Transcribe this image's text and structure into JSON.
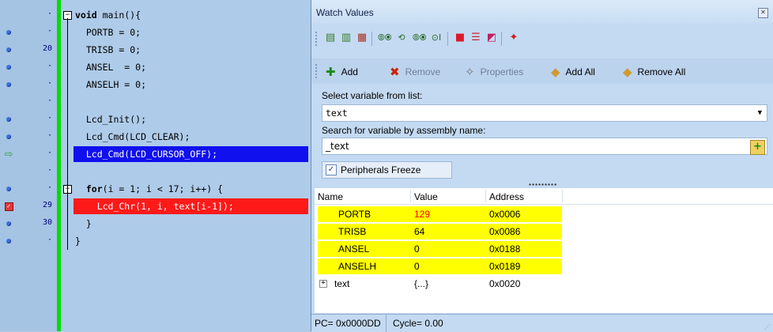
{
  "editor": {
    "lines": [
      {
        "icon": "none",
        "num": "·",
        "code": [
          {
            "t": "void",
            "kw": true
          },
          {
            "t": " main(){"
          }
        ],
        "highlight": "none",
        "fold": "minus"
      },
      {
        "icon": "breakpoint-dot",
        "num": "·",
        "code": [
          {
            "t": "  PORTB = 0;"
          }
        ],
        "highlight": "none"
      },
      {
        "icon": "breakpoint-dot",
        "num": "20",
        "code": [
          {
            "t": "  TRISB = 0;"
          }
        ],
        "highlight": "none"
      },
      {
        "icon": "breakpoint-dot",
        "num": "·",
        "code": [
          {
            "t": "  ANSEL  = 0;"
          }
        ],
        "highlight": "none"
      },
      {
        "icon": "breakpoint-dot",
        "num": "·",
        "code": [
          {
            "t": "  ANSELH = 0;"
          }
        ],
        "highlight": "none"
      },
      {
        "icon": "none",
        "num": "·",
        "code": [
          {
            "t": ""
          }
        ],
        "highlight": "none"
      },
      {
        "icon": "breakpoint-dot",
        "num": "·",
        "code": [
          {
            "t": "  Lcd_Init();"
          }
        ],
        "highlight": "none"
      },
      {
        "icon": "breakpoint-dot",
        "num": "·",
        "code": [
          {
            "t": "  Lcd_Cmd(LCD_CLEAR);"
          }
        ],
        "highlight": "none"
      },
      {
        "icon": "exec-arrow",
        "num": "·",
        "code": [
          {
            "t": "  Lcd_Cmd(LCD_CURSOR_OFF);"
          }
        ],
        "highlight": "blue"
      },
      {
        "icon": "none",
        "num": "·",
        "code": [
          {
            "t": ""
          }
        ],
        "highlight": "none"
      },
      {
        "icon": "breakpoint-dot",
        "num": "·",
        "code": [
          {
            "t": "  "
          },
          {
            "t": "for",
            "kw": true
          },
          {
            "t": "(i = 1; i < 17; i++) {"
          }
        ],
        "highlight": "none",
        "fold": "minus"
      },
      {
        "icon": "breakpoint-active",
        "num": "29",
        "code": [
          {
            "t": "    Lcd_Chr(1, i, text[i-1]);"
          }
        ],
        "highlight": "red"
      },
      {
        "icon": "breakpoint-dot",
        "num": "30",
        "code": [
          {
            "t": "  }"
          }
        ],
        "highlight": "none"
      },
      {
        "icon": "breakpoint-dot",
        "num": "·",
        "code": [
          {
            "t": "}"
          }
        ],
        "highlight": "none"
      }
    ]
  },
  "watch": {
    "title": "Watch Values",
    "close_icon": "close-icon",
    "toolbar_icons": [
      "add-watch-icon",
      "copy-watch-icon",
      "delete-watch-icon",
      "step-into-icon",
      "step-over-icon",
      "step-out-icon",
      "run-to-cursor-icon",
      "stop-icon",
      "list-icon",
      "clear-icon",
      "reset-icon"
    ],
    "actions": [
      {
        "label": "Add",
        "icon": "plus-icon",
        "color": "#1a8a1a",
        "disabled": false
      },
      {
        "label": "Remove",
        "icon": "remove-icon",
        "color": "#cc2200",
        "disabled": true
      },
      {
        "label": "Properties",
        "icon": "properties-icon",
        "color": "#888888",
        "disabled": true
      },
      {
        "label": "Add All",
        "icon": "add-all-icon",
        "color": "#1a8a1a",
        "disabled": false
      },
      {
        "label": "Remove All",
        "icon": "remove-all-icon",
        "color": "#cc2200",
        "disabled": false
      }
    ],
    "select_label": "Select variable from list:",
    "select_value": "text",
    "search_label": "Search for variable by assembly name:",
    "search_value": "_text",
    "freeze_label": "Peripherals Freeze",
    "freeze_checked": true,
    "columns": [
      "Name",
      "Value",
      "Address"
    ],
    "rows": [
      {
        "name": "PORTB",
        "value": "129",
        "address": "0x0006",
        "highlight": true,
        "value_red": true
      },
      {
        "name": "TRISB",
        "value": "64",
        "address": "0x0086",
        "highlight": true,
        "value_red": false
      },
      {
        "name": "ANSEL",
        "value": "0",
        "address": "0x0188",
        "highlight": true,
        "value_red": false
      },
      {
        "name": "ANSELH",
        "value": "0",
        "address": "0x0189",
        "highlight": true,
        "value_red": false
      },
      {
        "name": "text",
        "value": "{...}",
        "address": "0x0020",
        "highlight": false,
        "expandable": true
      }
    ],
    "status": {
      "pc": "PC= 0x0000DD",
      "cycle": "Cycle= 0.00"
    }
  },
  "colors": {
    "editor_bg": "#aecbe9",
    "exec_bar": "#00dd00",
    "current_line": "#1010ee",
    "breakpoint_line": "#ff1a1a",
    "watch_highlight": "#ffff00",
    "changed_value": "#ff0000"
  }
}
